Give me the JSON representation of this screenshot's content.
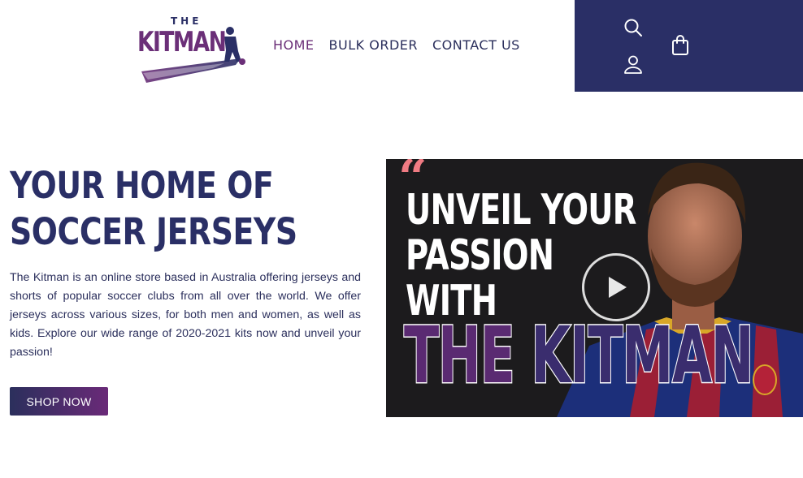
{
  "header": {
    "logo": {
      "top_text": "THE",
      "brand_text": "KITMAN"
    },
    "nav": [
      {
        "label": "HOME",
        "active": true
      },
      {
        "label": "BULK ORDER",
        "active": false
      },
      {
        "label": "CONTACT US",
        "active": false
      }
    ],
    "icons": {
      "search": "search-icon",
      "cart": "shopping-bag-icon",
      "account": "user-icon"
    }
  },
  "hero": {
    "headline_line1": "YOUR HOME OF",
    "headline_line2": "SOCCER JERSEYS",
    "description": "The Kitman is an online store based in Australia offering jerseys and shorts of popular soccer clubs from all over the world. We offer jerseys across various sizes, for both men and women, as well as kids. Explore our wide range of 2020-2021 kits now and unveil your passion!",
    "cta_label": "SHOP NOW"
  },
  "video": {
    "quote_mark": "“",
    "line1": "UNVEIL YOUR",
    "line2": "PASSION",
    "line3": "WITH",
    "brand_the": "THE ",
    "brand_kitman": "KITMAN"
  },
  "colors": {
    "navy": "#2a2f66",
    "purple": "#6b2f78",
    "video_bg": "#1c1b1d",
    "quote_pink": "#f07b83"
  }
}
